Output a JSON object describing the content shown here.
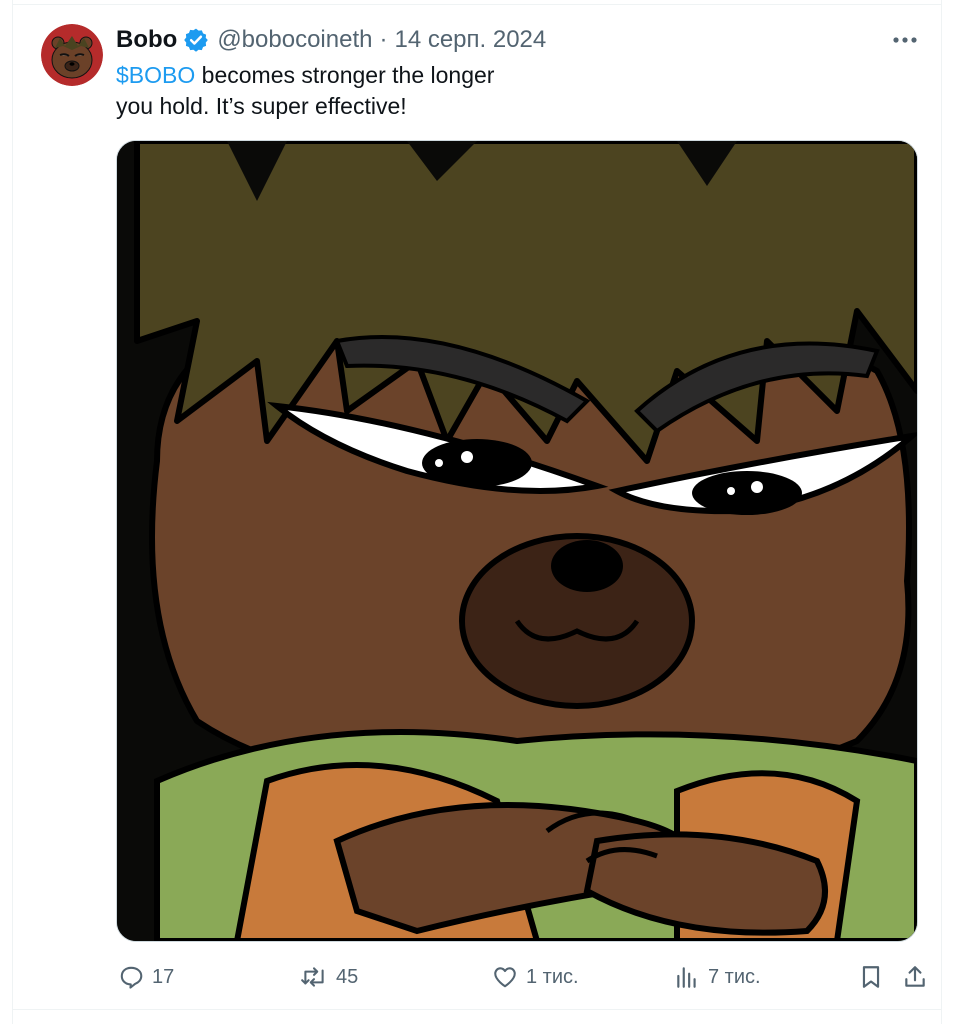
{
  "tweet": {
    "author_name": "Bobo",
    "handle": "@bobocoineth",
    "separator": "·",
    "date": "14 серп. 2024",
    "text_cashtag": "$BOBO",
    "text_line1_rest": " becomes stronger the longer",
    "text_line2": "you hold. It’s super effective!"
  },
  "actions": {
    "replies": "17",
    "reposts": "45",
    "likes": "1 тис.",
    "views": "7 тис."
  },
  "icons": {
    "verified": "verified-badge-icon",
    "more": "more-dots-icon",
    "reply": "reply-icon",
    "repost": "repost-icon",
    "like": "heart-icon",
    "views": "views-bar-icon",
    "bookmark": "bookmark-icon",
    "share": "share-icon"
  },
  "colors": {
    "accent": "#1d9bf0",
    "secondary_text": "#536471",
    "primary_text": "#0f1419"
  }
}
